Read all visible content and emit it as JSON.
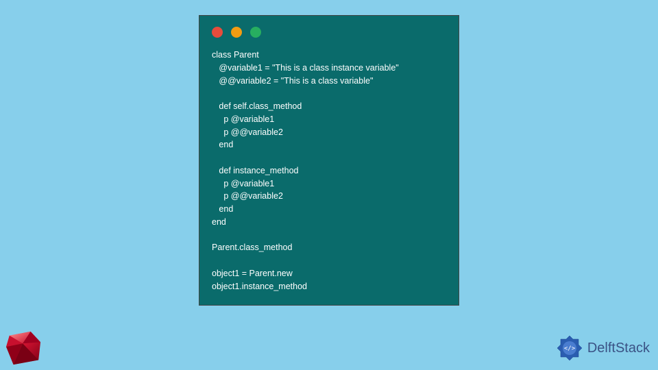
{
  "code": {
    "lines": [
      "class Parent",
      "   @variable1 = \"This is a class instance variable\"",
      "   @@variable2 = \"This is a class variable\"",
      "",
      "   def self.class_method",
      "     p @variable1",
      "     p @@variable2",
      "   end",
      "",
      "   def instance_method",
      "     p @variable1",
      "     p @@variable2",
      "   end",
      "end",
      "",
      "Parent.class_method",
      "",
      "object1 = Parent.new",
      "object1.instance_method"
    ]
  },
  "branding": {
    "site_name": "DelftStack"
  }
}
